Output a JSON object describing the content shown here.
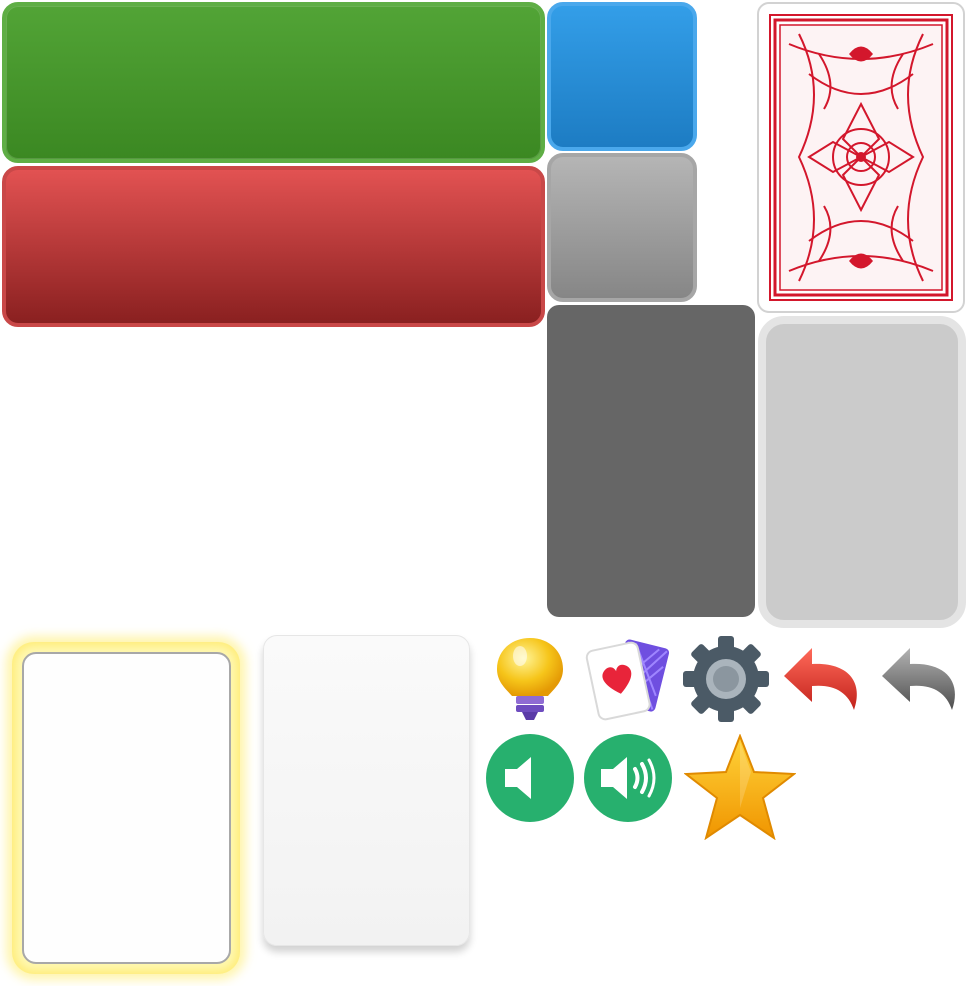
{
  "sprites": {
    "buttons": [
      "green-button",
      "red-button",
      "blue-button",
      "gray-button"
    ],
    "card_slots": [
      "dark-slot",
      "light-slot"
    ],
    "cards": [
      "card-back-red",
      "card-highlighted",
      "card-blank"
    ],
    "icons": [
      "lightbulb-icon",
      "cards-icon",
      "gear-icon",
      "undo-red-icon",
      "undo-gray-icon",
      "sound-off-icon",
      "sound-on-icon",
      "star-icon"
    ]
  },
  "colors": {
    "green": "#4a9a2e",
    "red": "#c94848",
    "blue": "#2b8fd8",
    "gray": "#9e9e9e",
    "slot_dark": "#666666",
    "slot_light": "#cbcbcb",
    "card_back": "#d3172c",
    "sound_button": "#27b06e",
    "star": "#f5b400"
  }
}
